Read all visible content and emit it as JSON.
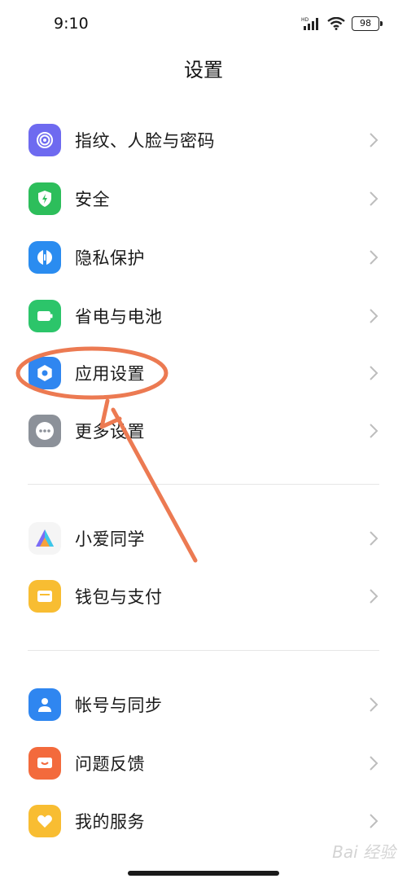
{
  "status_bar": {
    "time": "9:10",
    "network": "HD",
    "battery": "98"
  },
  "header": {
    "title": "设置"
  },
  "groups": [
    {
      "items": [
        {
          "label": "指纹、人脸与密码",
          "icon": "fingerprint-icon",
          "color": "#6e6af0"
        },
        {
          "label": "安全",
          "icon": "shield-bolt-icon",
          "color": "#2dbe5b"
        },
        {
          "label": "隐私保护",
          "icon": "privacy-icon",
          "color": "#2a8cf0"
        },
        {
          "label": "省电与电池",
          "icon": "battery-icon",
          "color": "#2cc56a"
        },
        {
          "label": "应用设置",
          "icon": "gear-icon",
          "color": "#2f86f0"
        },
        {
          "label": "更多设置",
          "icon": "more-dots-icon",
          "color": "#8c9199"
        }
      ]
    },
    {
      "items": [
        {
          "label": "小爱同学",
          "icon": "assistant-icon",
          "color": "#f5f5f5"
        },
        {
          "label": "钱包与支付",
          "icon": "wallet-icon",
          "color": "#f8bd32"
        }
      ]
    },
    {
      "items": [
        {
          "label": "帐号与同步",
          "icon": "account-icon",
          "color": "#2f86f0"
        },
        {
          "label": "问题反馈",
          "icon": "feedback-icon",
          "color": "#f36a3c"
        },
        {
          "label": "我的服务",
          "icon": "heart-icon",
          "color": "#f8bd32"
        }
      ]
    }
  ],
  "annotation_color": "#ec7a52",
  "watermark": "Bai 经验"
}
